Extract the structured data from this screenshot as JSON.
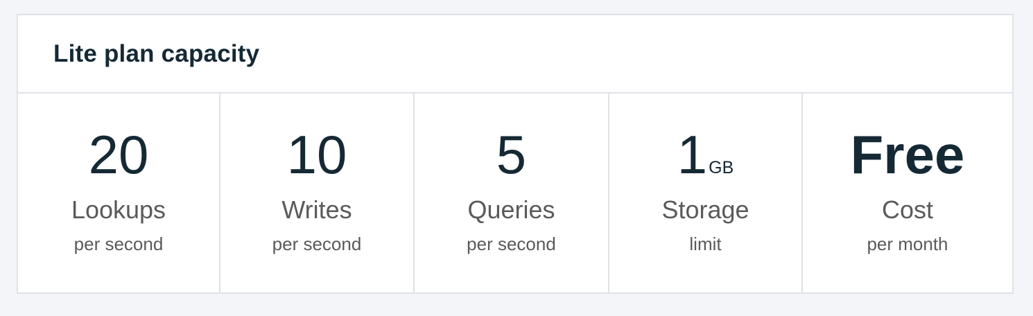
{
  "card": {
    "title": "Lite plan capacity"
  },
  "stats": [
    {
      "value": "20",
      "unit": "",
      "label": "Lookups",
      "sub": "per second"
    },
    {
      "value": "10",
      "unit": "",
      "label": "Writes",
      "sub": "per second"
    },
    {
      "value": "5",
      "unit": "",
      "label": "Queries",
      "sub": "per second"
    },
    {
      "value": "1",
      "unit": "GB",
      "label": "Storage",
      "sub": "limit"
    },
    {
      "value": "Free",
      "unit": "",
      "label": "Cost",
      "sub": "per month"
    }
  ],
  "colors": {
    "page_background": "#f4f5f8",
    "card_background": "#ffffff",
    "border": "#dfe1e6",
    "title_text": "#152935",
    "label_text": "#5a5a5a"
  }
}
